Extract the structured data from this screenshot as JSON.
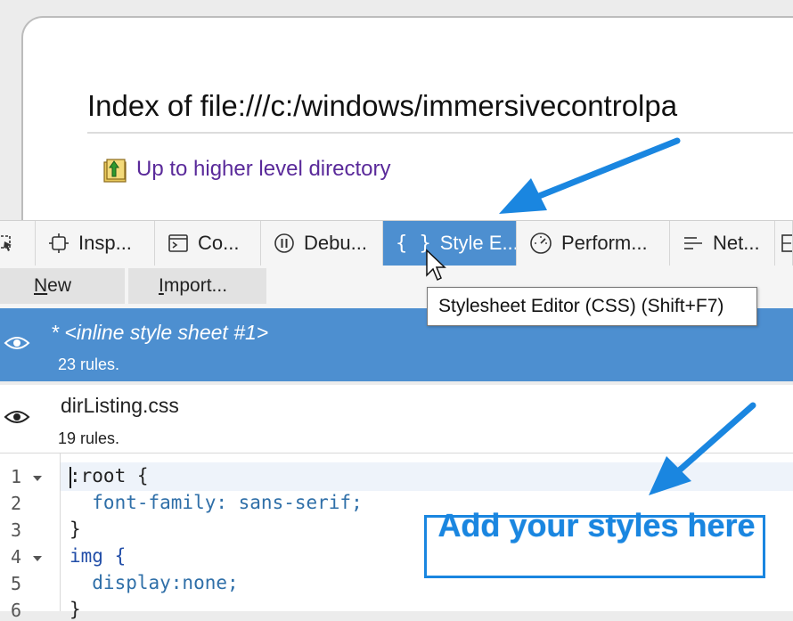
{
  "page": {
    "title": "Index of file:///c:/windows/immersivecontrolpa",
    "up_link": "Up to higher level directory"
  },
  "devtools": {
    "tabs": [
      {
        "label": "",
        "icon": "element-picker-icon"
      },
      {
        "label": "Insp...",
        "icon": "inspector-icon"
      },
      {
        "label": "Co...",
        "icon": "console-icon"
      },
      {
        "label": "Debu...",
        "icon": "debugger-icon"
      },
      {
        "label": "Style E...",
        "icon": "braces-icon",
        "selected": true
      },
      {
        "label": "Perform...",
        "icon": "performance-icon"
      },
      {
        "label": "Net...",
        "icon": "network-icon"
      }
    ],
    "toolbar": {
      "new_label": "New",
      "import_label": "Import..."
    },
    "tooltip": "Stylesheet Editor (CSS) (Shift+F7)",
    "stylesheets": [
      {
        "name": "* <inline style sheet #1>",
        "rules": "23 rules.",
        "selected": true
      },
      {
        "name": "dirListing.css",
        "rules": "19 rules."
      }
    ],
    "editor": {
      "line_numbers": [
        "1",
        "2",
        "3",
        "4",
        "5",
        "6"
      ],
      "lines": [
        ":root {",
        "  font-family: sans-serif;",
        "}",
        "img {",
        "  display:none;",
        "}"
      ]
    }
  },
  "annotation": {
    "text": "Add your styles here"
  },
  "colors": {
    "accent": "#4d8fd0",
    "annotation": "#1a86e0",
    "link": "#5a2a9a"
  }
}
